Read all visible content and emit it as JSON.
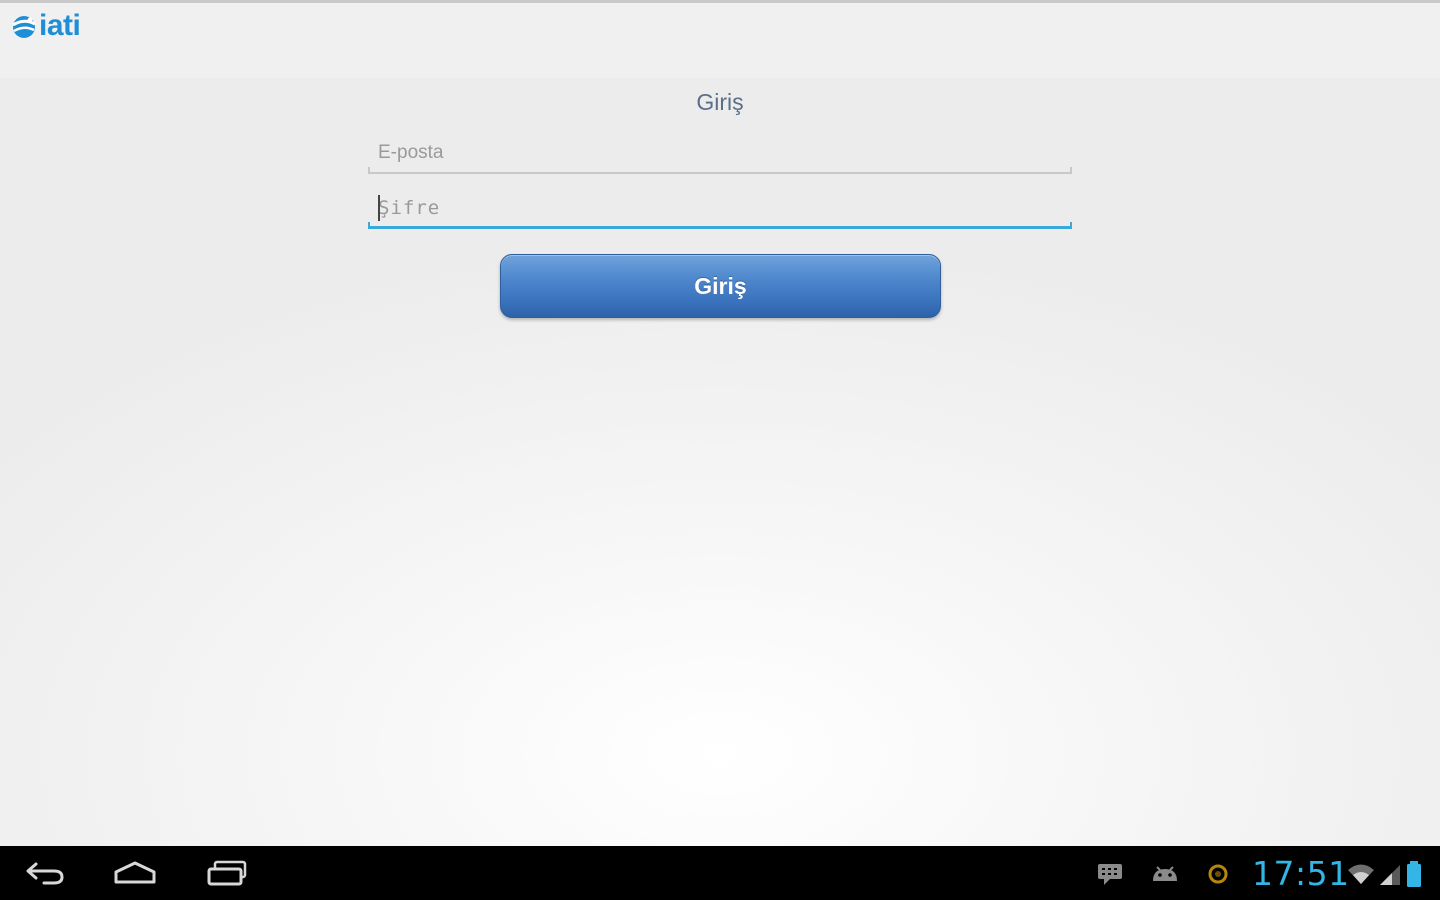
{
  "app": {
    "logo_text": "iati"
  },
  "login": {
    "title": "Giriş",
    "email_placeholder": "E-posta",
    "password_placeholder": "Şifre",
    "submit_label": "Giriş"
  },
  "system_bar": {
    "clock": "17:51",
    "accent_color": "#33b5e5",
    "nav_icons": [
      "back-icon",
      "home-icon",
      "recent-apps-icon"
    ],
    "status_icons": [
      "message-icon",
      "android-debug-icon",
      "sync-icon",
      "wifi-icon",
      "signal-icon",
      "battery-icon"
    ]
  },
  "colors": {
    "brand": "#1e8fd6",
    "button": "#3a73bd",
    "focus_underline": "#39a9dc"
  }
}
